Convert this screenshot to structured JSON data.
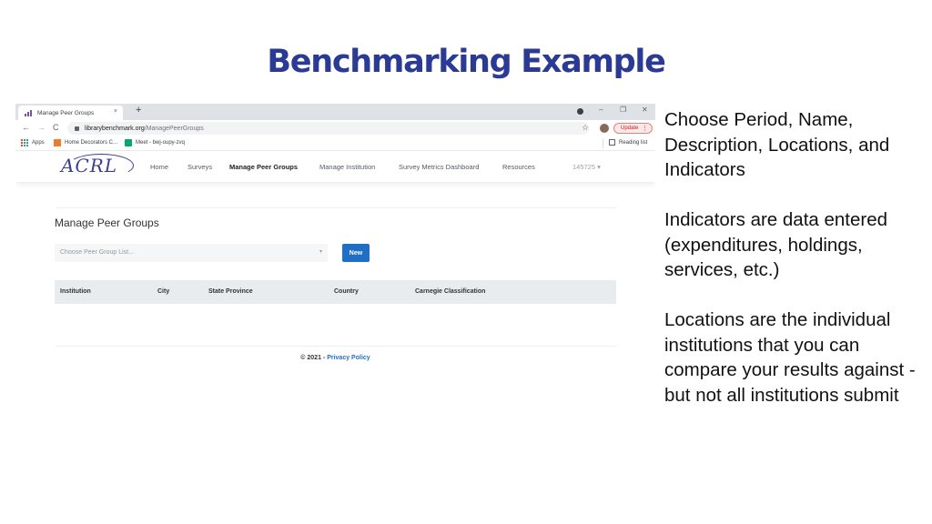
{
  "slide": {
    "title": "Benchmarking Example",
    "title_color": "#2b3a94"
  },
  "browser": {
    "tab_title": "Manage Peer Groups",
    "tab_close": "×",
    "new_tab": "+",
    "window_controls": {
      "minimize": "–",
      "restore": "❐",
      "close": "✕"
    },
    "nav": {
      "back": "←",
      "forward": "→",
      "reload": "C"
    },
    "url_domain": "librarybenchmark.org",
    "url_path": "/ManagePeerGroups",
    "star": "☆",
    "update_label": "Update",
    "update_menu": "⋮",
    "bookmarks": [
      {
        "label": "Apps",
        "icon": "apps-grid-icon"
      },
      {
        "label": "Home Decorators C...",
        "icon": "home-decorators-icon"
      },
      {
        "label": "Meet - bwj-oupy-zvq",
        "icon": "google-meet-icon"
      }
    ],
    "reading_list": "Reading list"
  },
  "site": {
    "logo": "ACRL",
    "nav_items": [
      {
        "label": "Home",
        "active": false
      },
      {
        "label": "Surveys",
        "active": false
      },
      {
        "label": "Manage Peer Groups",
        "active": true
      },
      {
        "label": "Manage Institution",
        "active": false
      },
      {
        "label": "Survey Metrics Dashboard",
        "active": false
      },
      {
        "label": "Resources",
        "active": false
      }
    ],
    "user_id": "145725 ▾",
    "page_heading": "Manage Peer Groups",
    "select_placeholder": "Choose Peer Group List...",
    "select_caret": "▾",
    "new_button": "New",
    "table_columns": [
      "Institution",
      "City",
      "State Province",
      "Country",
      "Carnegie Classification"
    ],
    "footer_copyright": "© 2021 - ",
    "footer_link": "Privacy Policy",
    "accent_color": "#1f6fc5"
  },
  "notes": [
    "Choose Period, Name, Description, Locations, and Indicators",
    "Indicators are data entered (expenditures, holdings, services, etc.)",
    "Locations are the individual institutions that you can compare your results against - but not all institutions submit"
  ]
}
